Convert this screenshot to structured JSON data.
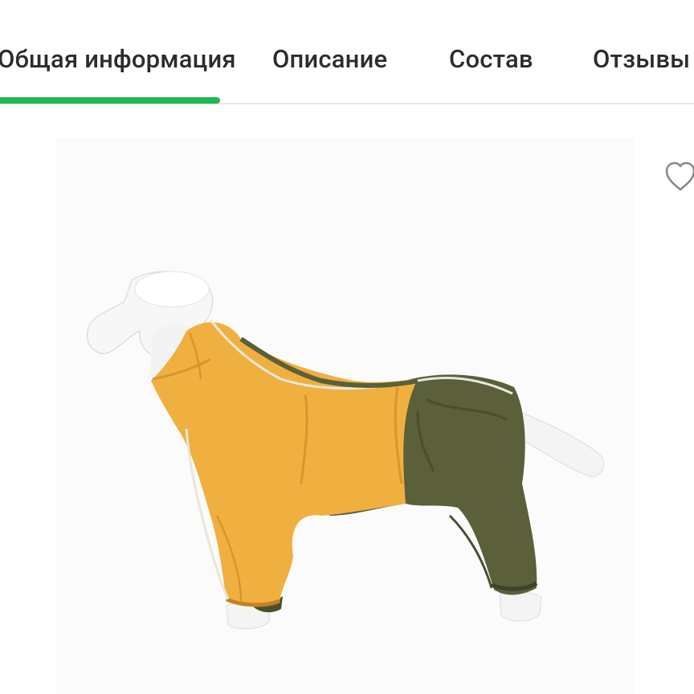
{
  "tabs": [
    {
      "label": "Общая информация",
      "active": true
    },
    {
      "label": "Описание",
      "active": false
    },
    {
      "label": "Состав",
      "active": false
    },
    {
      "label": "Отзывы",
      "active": false
    }
  ],
  "colors": {
    "accent": "#1db954",
    "suit_yellow": "#f0b03f",
    "suit_olive": "#5b5f3a"
  },
  "product": {
    "image_subject": "dog-raincoat-overall-yellow-olive",
    "favorite_icon": "heart-outline-icon"
  }
}
